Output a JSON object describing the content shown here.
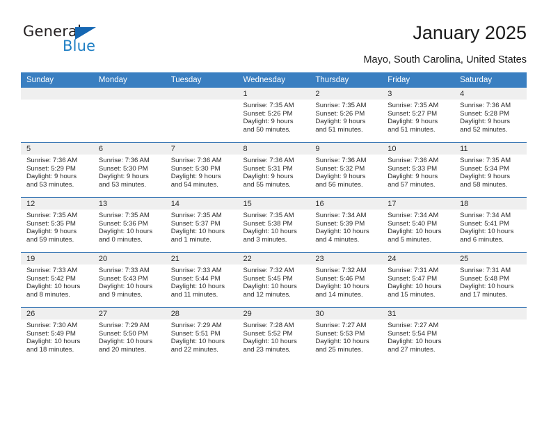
{
  "brand": {
    "name_part1": "General",
    "name_part2": "Blue",
    "accent_color": "#1f7fc4",
    "triangle_color": "#1567b3"
  },
  "header": {
    "title": "January 2025",
    "subtitle": "Mayo, South Carolina, United States"
  },
  "calendar": {
    "header_bg": "#3a7fc1",
    "day_band_bg": "#efefef",
    "row_rule_color": "#2a6db0",
    "weekday_headers": [
      "Sunday",
      "Monday",
      "Tuesday",
      "Wednesday",
      "Thursday",
      "Friday",
      "Saturday"
    ],
    "weeks": [
      [
        {
          "day": "",
          "sunrise": "",
          "sunset": "",
          "daylight1": "",
          "daylight2": ""
        },
        {
          "day": "",
          "sunrise": "",
          "sunset": "",
          "daylight1": "",
          "daylight2": ""
        },
        {
          "day": "",
          "sunrise": "",
          "sunset": "",
          "daylight1": "",
          "daylight2": ""
        },
        {
          "day": "1",
          "sunrise": "Sunrise: 7:35 AM",
          "sunset": "Sunset: 5:26 PM",
          "daylight1": "Daylight: 9 hours",
          "daylight2": "and 50 minutes."
        },
        {
          "day": "2",
          "sunrise": "Sunrise: 7:35 AM",
          "sunset": "Sunset: 5:26 PM",
          "daylight1": "Daylight: 9 hours",
          "daylight2": "and 51 minutes."
        },
        {
          "day": "3",
          "sunrise": "Sunrise: 7:35 AM",
          "sunset": "Sunset: 5:27 PM",
          "daylight1": "Daylight: 9 hours",
          "daylight2": "and 51 minutes."
        },
        {
          "day": "4",
          "sunrise": "Sunrise: 7:36 AM",
          "sunset": "Sunset: 5:28 PM",
          "daylight1": "Daylight: 9 hours",
          "daylight2": "and 52 minutes."
        }
      ],
      [
        {
          "day": "5",
          "sunrise": "Sunrise: 7:36 AM",
          "sunset": "Sunset: 5:29 PM",
          "daylight1": "Daylight: 9 hours",
          "daylight2": "and 53 minutes."
        },
        {
          "day": "6",
          "sunrise": "Sunrise: 7:36 AM",
          "sunset": "Sunset: 5:30 PM",
          "daylight1": "Daylight: 9 hours",
          "daylight2": "and 53 minutes."
        },
        {
          "day": "7",
          "sunrise": "Sunrise: 7:36 AM",
          "sunset": "Sunset: 5:30 PM",
          "daylight1": "Daylight: 9 hours",
          "daylight2": "and 54 minutes."
        },
        {
          "day": "8",
          "sunrise": "Sunrise: 7:36 AM",
          "sunset": "Sunset: 5:31 PM",
          "daylight1": "Daylight: 9 hours",
          "daylight2": "and 55 minutes."
        },
        {
          "day": "9",
          "sunrise": "Sunrise: 7:36 AM",
          "sunset": "Sunset: 5:32 PM",
          "daylight1": "Daylight: 9 hours",
          "daylight2": "and 56 minutes."
        },
        {
          "day": "10",
          "sunrise": "Sunrise: 7:36 AM",
          "sunset": "Sunset: 5:33 PM",
          "daylight1": "Daylight: 9 hours",
          "daylight2": "and 57 minutes."
        },
        {
          "day": "11",
          "sunrise": "Sunrise: 7:35 AM",
          "sunset": "Sunset: 5:34 PM",
          "daylight1": "Daylight: 9 hours",
          "daylight2": "and 58 minutes."
        }
      ],
      [
        {
          "day": "12",
          "sunrise": "Sunrise: 7:35 AM",
          "sunset": "Sunset: 5:35 PM",
          "daylight1": "Daylight: 9 hours",
          "daylight2": "and 59 minutes."
        },
        {
          "day": "13",
          "sunrise": "Sunrise: 7:35 AM",
          "sunset": "Sunset: 5:36 PM",
          "daylight1": "Daylight: 10 hours",
          "daylight2": "and 0 minutes."
        },
        {
          "day": "14",
          "sunrise": "Sunrise: 7:35 AM",
          "sunset": "Sunset: 5:37 PM",
          "daylight1": "Daylight: 10 hours",
          "daylight2": "and 1 minute."
        },
        {
          "day": "15",
          "sunrise": "Sunrise: 7:35 AM",
          "sunset": "Sunset: 5:38 PM",
          "daylight1": "Daylight: 10 hours",
          "daylight2": "and 3 minutes."
        },
        {
          "day": "16",
          "sunrise": "Sunrise: 7:34 AM",
          "sunset": "Sunset: 5:39 PM",
          "daylight1": "Daylight: 10 hours",
          "daylight2": "and 4 minutes."
        },
        {
          "day": "17",
          "sunrise": "Sunrise: 7:34 AM",
          "sunset": "Sunset: 5:40 PM",
          "daylight1": "Daylight: 10 hours",
          "daylight2": "and 5 minutes."
        },
        {
          "day": "18",
          "sunrise": "Sunrise: 7:34 AM",
          "sunset": "Sunset: 5:41 PM",
          "daylight1": "Daylight: 10 hours",
          "daylight2": "and 6 minutes."
        }
      ],
      [
        {
          "day": "19",
          "sunrise": "Sunrise: 7:33 AM",
          "sunset": "Sunset: 5:42 PM",
          "daylight1": "Daylight: 10 hours",
          "daylight2": "and 8 minutes."
        },
        {
          "day": "20",
          "sunrise": "Sunrise: 7:33 AM",
          "sunset": "Sunset: 5:43 PM",
          "daylight1": "Daylight: 10 hours",
          "daylight2": "and 9 minutes."
        },
        {
          "day": "21",
          "sunrise": "Sunrise: 7:33 AM",
          "sunset": "Sunset: 5:44 PM",
          "daylight1": "Daylight: 10 hours",
          "daylight2": "and 11 minutes."
        },
        {
          "day": "22",
          "sunrise": "Sunrise: 7:32 AM",
          "sunset": "Sunset: 5:45 PM",
          "daylight1": "Daylight: 10 hours",
          "daylight2": "and 12 minutes."
        },
        {
          "day": "23",
          "sunrise": "Sunrise: 7:32 AM",
          "sunset": "Sunset: 5:46 PM",
          "daylight1": "Daylight: 10 hours",
          "daylight2": "and 14 minutes."
        },
        {
          "day": "24",
          "sunrise": "Sunrise: 7:31 AM",
          "sunset": "Sunset: 5:47 PM",
          "daylight1": "Daylight: 10 hours",
          "daylight2": "and 15 minutes."
        },
        {
          "day": "25",
          "sunrise": "Sunrise: 7:31 AM",
          "sunset": "Sunset: 5:48 PM",
          "daylight1": "Daylight: 10 hours",
          "daylight2": "and 17 minutes."
        }
      ],
      [
        {
          "day": "26",
          "sunrise": "Sunrise: 7:30 AM",
          "sunset": "Sunset: 5:49 PM",
          "daylight1": "Daylight: 10 hours",
          "daylight2": "and 18 minutes."
        },
        {
          "day": "27",
          "sunrise": "Sunrise: 7:29 AM",
          "sunset": "Sunset: 5:50 PM",
          "daylight1": "Daylight: 10 hours",
          "daylight2": "and 20 minutes."
        },
        {
          "day": "28",
          "sunrise": "Sunrise: 7:29 AM",
          "sunset": "Sunset: 5:51 PM",
          "daylight1": "Daylight: 10 hours",
          "daylight2": "and 22 minutes."
        },
        {
          "day": "29",
          "sunrise": "Sunrise: 7:28 AM",
          "sunset": "Sunset: 5:52 PM",
          "daylight1": "Daylight: 10 hours",
          "daylight2": "and 23 minutes."
        },
        {
          "day": "30",
          "sunrise": "Sunrise: 7:27 AM",
          "sunset": "Sunset: 5:53 PM",
          "daylight1": "Daylight: 10 hours",
          "daylight2": "and 25 minutes."
        },
        {
          "day": "31",
          "sunrise": "Sunrise: 7:27 AM",
          "sunset": "Sunset: 5:54 PM",
          "daylight1": "Daylight: 10 hours",
          "daylight2": "and 27 minutes."
        },
        {
          "day": "",
          "sunrise": "",
          "sunset": "",
          "daylight1": "",
          "daylight2": ""
        }
      ]
    ]
  }
}
